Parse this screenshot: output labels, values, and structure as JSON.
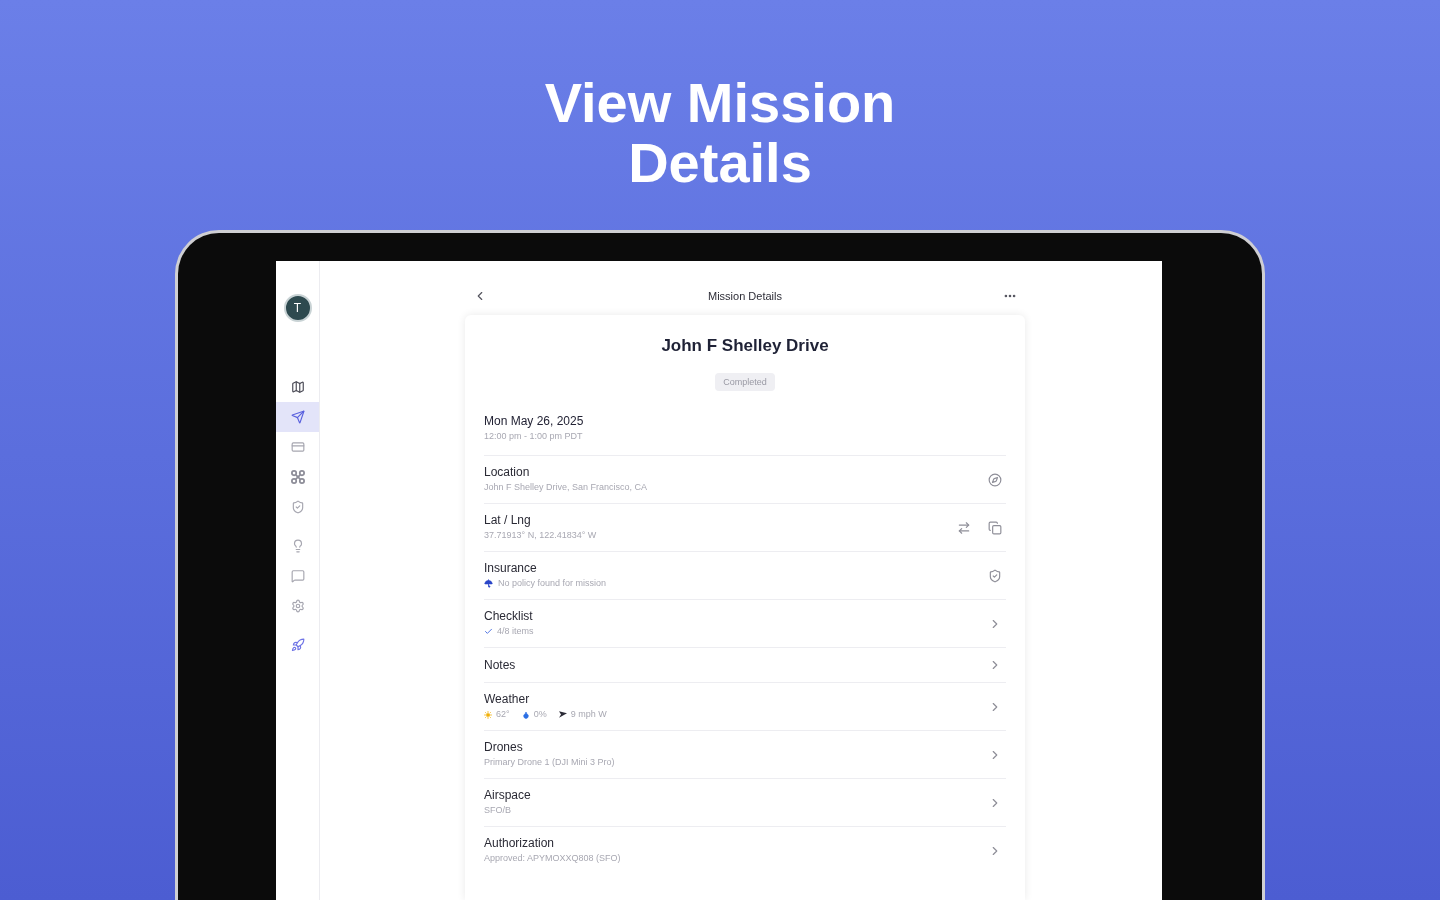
{
  "headline": "View Mission Details",
  "sidebar": {
    "avatar": "T",
    "groups": [
      {
        "items": [
          {
            "kind": "map",
            "selected": false
          },
          {
            "kind": "missions",
            "selected": true
          },
          {
            "kind": "card",
            "selected": false
          },
          {
            "kind": "drone",
            "selected": false
          },
          {
            "kind": "shield",
            "selected": false
          }
        ]
      },
      {
        "items": [
          {
            "kind": "bulb",
            "selected": false
          },
          {
            "kind": "chat",
            "selected": false
          },
          {
            "kind": "settings",
            "selected": false
          }
        ]
      },
      {
        "items": [
          {
            "kind": "launch",
            "selected": false
          }
        ]
      }
    ]
  },
  "header": {
    "title": "Mission Details"
  },
  "mission": {
    "title": "John F Shelley Drive",
    "status": "Completed",
    "date": "Mon May 26, 2025",
    "time": "12:00 pm - 1:00 pm PDT",
    "rows": [
      {
        "kind": "location",
        "label": "Location",
        "value": "John F Shelley Drive, San Francisco, CA"
      },
      {
        "kind": "coordinates",
        "label": "Lat / Lng",
        "value": "37.71913° N, 122.41834° W"
      },
      {
        "kind": "insurance",
        "label": "Insurance",
        "value": "No policy found for mission"
      },
      {
        "kind": "checklist",
        "label": "Checklist",
        "value": "4/8 items",
        "checked": true
      },
      {
        "kind": "link",
        "label": "Notes"
      },
      {
        "kind": "weather",
        "label": "Weather",
        "conditions": [
          {
            "kind": "sun",
            "text": "62°"
          },
          {
            "kind": "rain",
            "text": "0%"
          },
          {
            "kind": "wind",
            "text": "9 mph W"
          }
        ]
      },
      {
        "kind": "link",
        "label": "Drones",
        "value": "Primary Drone 1 (DJI Mini 3 Pro)"
      },
      {
        "kind": "link",
        "label": "Airspace",
        "value": "SFO/B"
      },
      {
        "kind": "link",
        "label": "Authorization",
        "value": "Approved: APYMOXXQ808 (SFO)"
      }
    ]
  }
}
